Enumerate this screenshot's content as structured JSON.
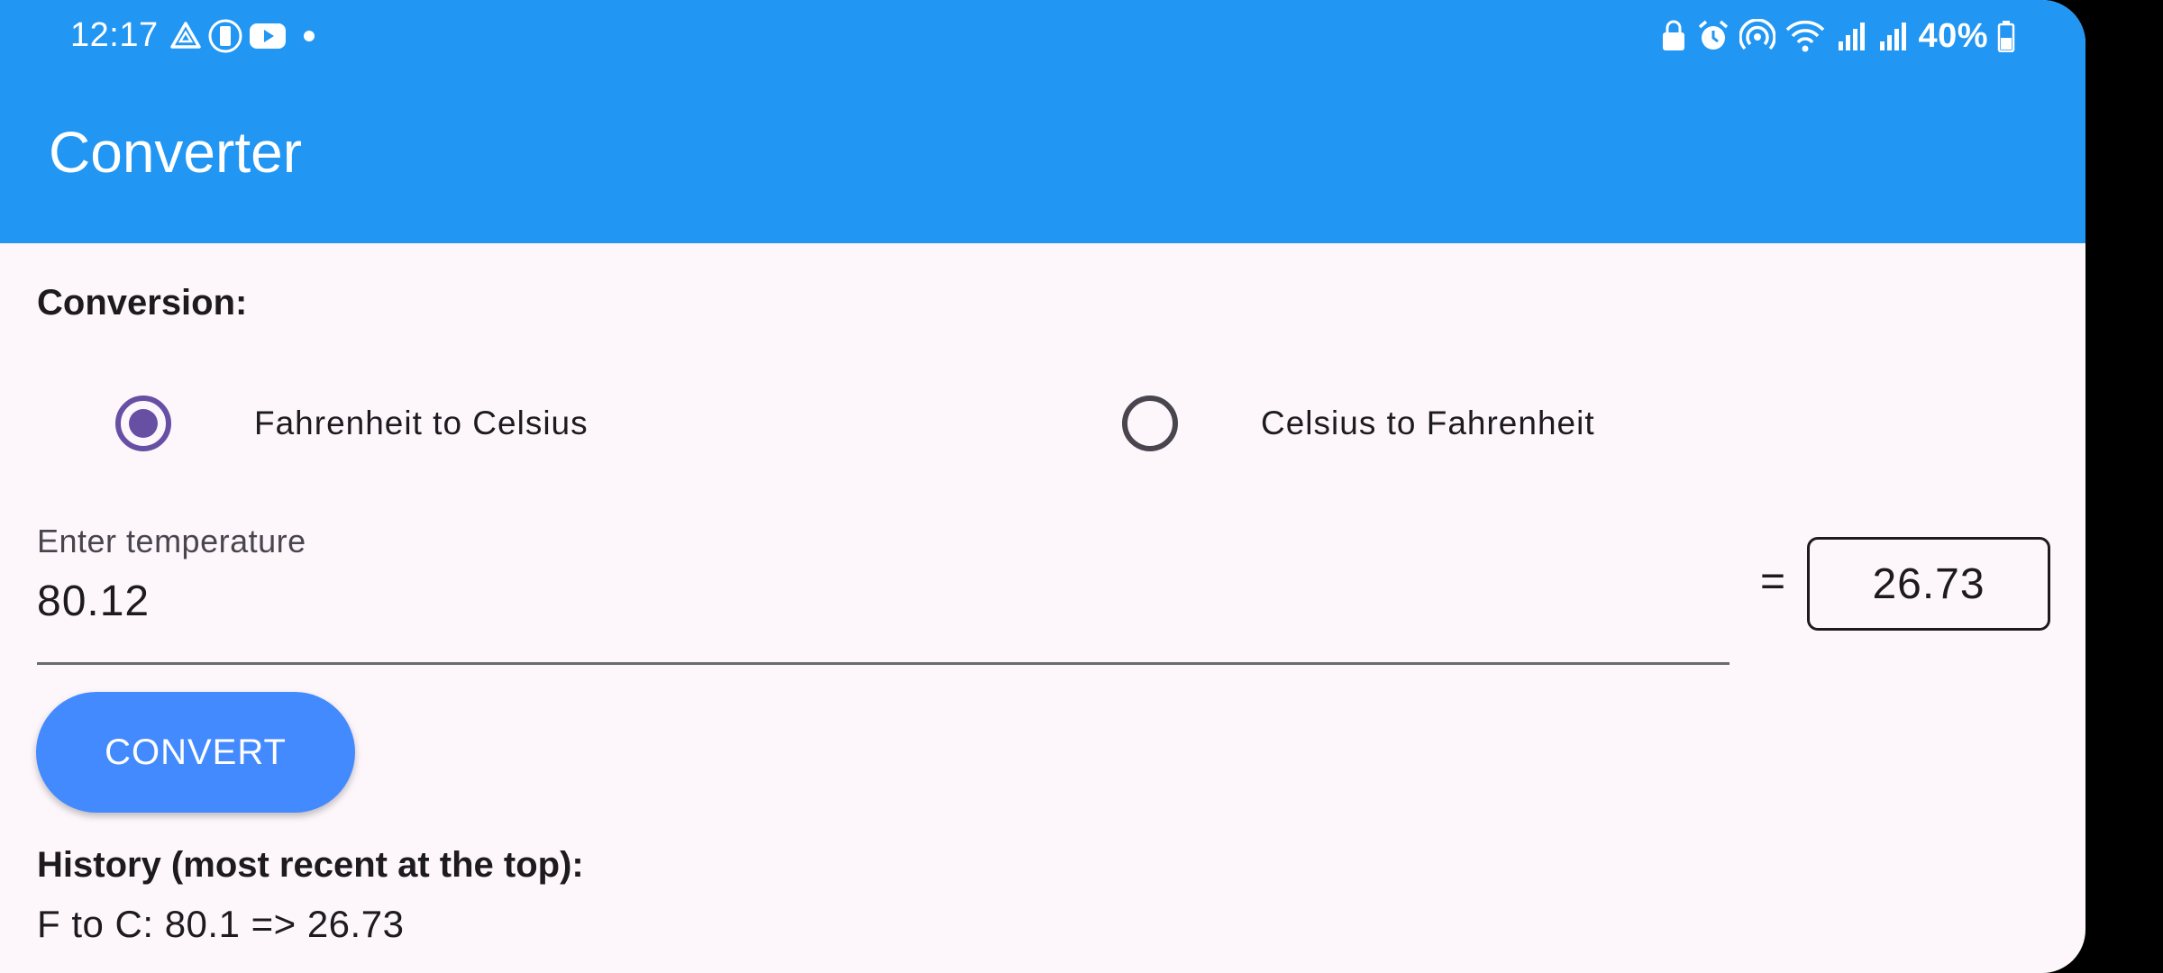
{
  "status_bar": {
    "time": "12:17",
    "battery_percent": "40%",
    "left_icons": [
      "drive-icon",
      "vibrate-icon",
      "youtube-icon",
      "dot-icon"
    ],
    "right_icons": [
      "lock-icon",
      "alarm-icon",
      "hotspot-icon",
      "wifi-icon",
      "signal-icon",
      "signal-icon",
      "battery-icon"
    ]
  },
  "app_bar": {
    "title": "Converter"
  },
  "conversion": {
    "label": "Conversion:",
    "options": [
      {
        "label": "Fahrenheit to Celsius",
        "selected": true
      },
      {
        "label": "Celsius to Fahrenheit",
        "selected": false
      }
    ]
  },
  "temperature_input": {
    "label": "Enter temperature",
    "value": "80.12"
  },
  "result": {
    "equals": "=",
    "value": "26.73"
  },
  "convert_button": {
    "label": "CONVERT"
  },
  "history": {
    "title": "History (most recent at the top):",
    "items": [
      "F to C: 80.1 => 26.73"
    ]
  },
  "colors": {
    "app_bar": "#2196f3",
    "background": "#fdf7fc",
    "radio_selected": "#6750a4",
    "button": "#448aff"
  }
}
